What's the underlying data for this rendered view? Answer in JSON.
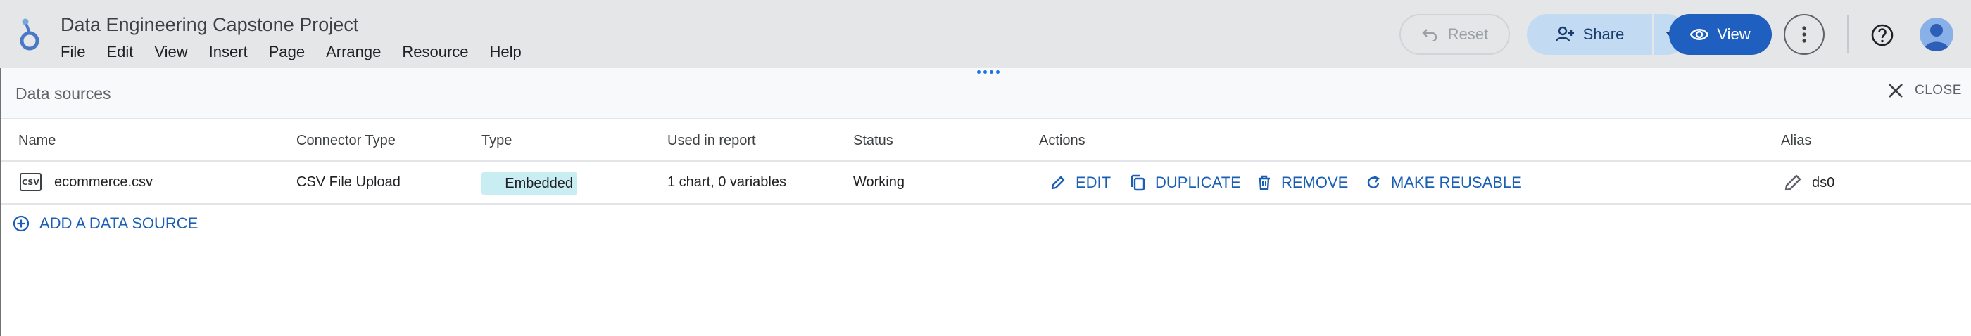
{
  "header": {
    "doc_title": "Data Engineering Capstone Project",
    "menu": [
      "File",
      "Edit",
      "View",
      "Insert",
      "Page",
      "Arrange",
      "Resource",
      "Help"
    ],
    "reset_label": "Reset",
    "share_label": "Share",
    "view_label": "View",
    "accent_color": "#1f5fbf"
  },
  "panel": {
    "title": "Data sources",
    "close_label": "CLOSE",
    "columns": [
      "Name",
      "Connector Type",
      "Type",
      "Used in report",
      "Status",
      "Actions",
      "Alias"
    ],
    "rows": [
      {
        "file_icon": "CSV",
        "name": "ecommerce.csv",
        "connector": "CSV File Upload",
        "type": "Embedded",
        "used": "1 chart, 0 variables",
        "status": "Working",
        "actions": [
          "EDIT",
          "DUPLICATE",
          "REMOVE",
          "MAKE REUSABLE"
        ],
        "alias": "ds0"
      }
    ],
    "add_label": "ADD A DATA SOURCE"
  },
  "icons": {
    "logo": "looker-studio-logo",
    "reset": "undo-icon",
    "share": "person-add-icon",
    "view": "eye-icon",
    "more": "more-vert-icon",
    "help": "help-icon",
    "close": "close-icon",
    "edit": "pencil-icon",
    "duplicate": "copy-icon",
    "remove": "trash-icon",
    "reusable": "redo-icon",
    "add": "add-circle-icon"
  }
}
